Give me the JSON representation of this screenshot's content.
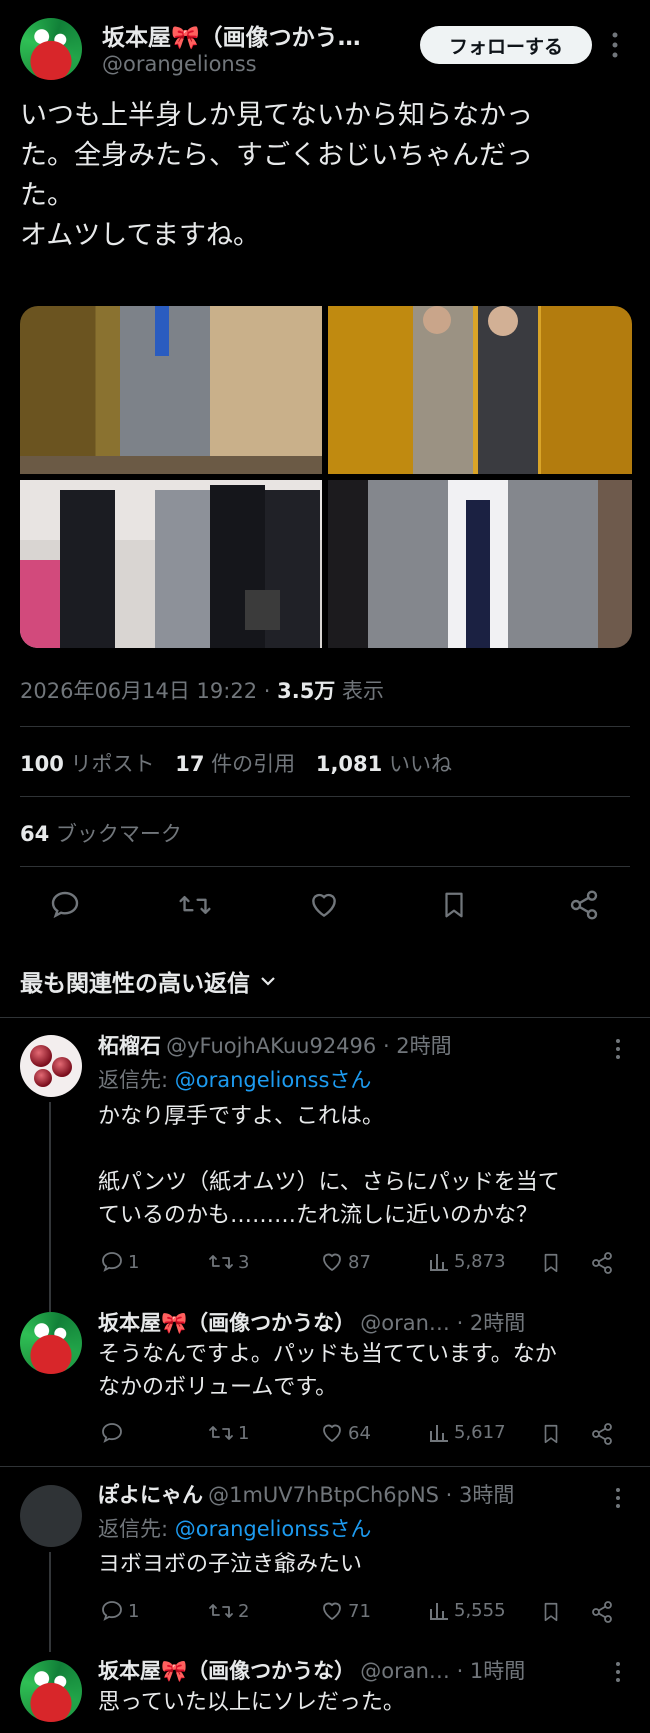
{
  "tweet": {
    "author_name": "坂本屋🎀（画像つかう…",
    "author_handle": "@orangelionss",
    "follow_label": "フォローする",
    "text_lines": [
      "いつも上半身しか見てないから知らなかっ",
      "た。全身みたら、すごくおじいちゃんだっ",
      "た。",
      "オムツしてますね。"
    ],
    "date": "2026年06月14日 19:22 · ",
    "views_count": "3.5万",
    "views_label": " 表示",
    "reposts_count": "100",
    "reposts_label": "リポスト",
    "quotes_count": "17",
    "quotes_label": "件の引用",
    "likes_count": "1,081",
    "likes_label": "いいね",
    "bookmarks_count": "64",
    "bookmarks_label": "ブックマーク"
  },
  "sort": {
    "label": "最も関連性の高い返信",
    "chevron": "chevron-down-icon"
  },
  "replies": [
    {
      "name": "柘榴石",
      "handle": "@yFuojhAKuu92496 · 2時間",
      "reply_to_prefix": "返信先: ",
      "reply_to_handle": "@orangelionssさん",
      "lines": [
        "かなり厚手ですよ、これは。",
        "",
        "紙パンツ（紙オムツ）に、さらにパッドを当て",
        "ているのかも………たれ流しに近いのかな？"
      ],
      "replies": "1",
      "reposts": "3",
      "likes": "87",
      "views": "5,873"
    },
    {
      "name": "坂本屋🎀（画像つかうな）",
      "handle": "@oran… · 2時間",
      "lines": [
        "そうなんですよ。パッドも当てています。なか",
        "なかのボリュームです。"
      ],
      "replies": "",
      "reposts": "1",
      "likes": "64",
      "views": "5,617"
    },
    {
      "name": "ぽよにゃん",
      "handle": "@1mUV7hBtpCh6pNS · 3時間",
      "reply_to_prefix": "返信先: ",
      "reply_to_handle": "@orangelionssさん",
      "lines": [
        "ヨボヨボの子泣き爺みたい"
      ],
      "replies": "1",
      "reposts": "2",
      "likes": "71",
      "views": "5,555"
    },
    {
      "name": "坂本屋🎀（画像つかうな）",
      "handle": "@oran… · 1時間",
      "lines": [
        "思っていた以上にソレだった。"
      ]
    }
  ],
  "colors": {
    "background": "#000000",
    "text": "#e7e9ea",
    "muted": "#71767b",
    "link": "#1d9bf0"
  }
}
